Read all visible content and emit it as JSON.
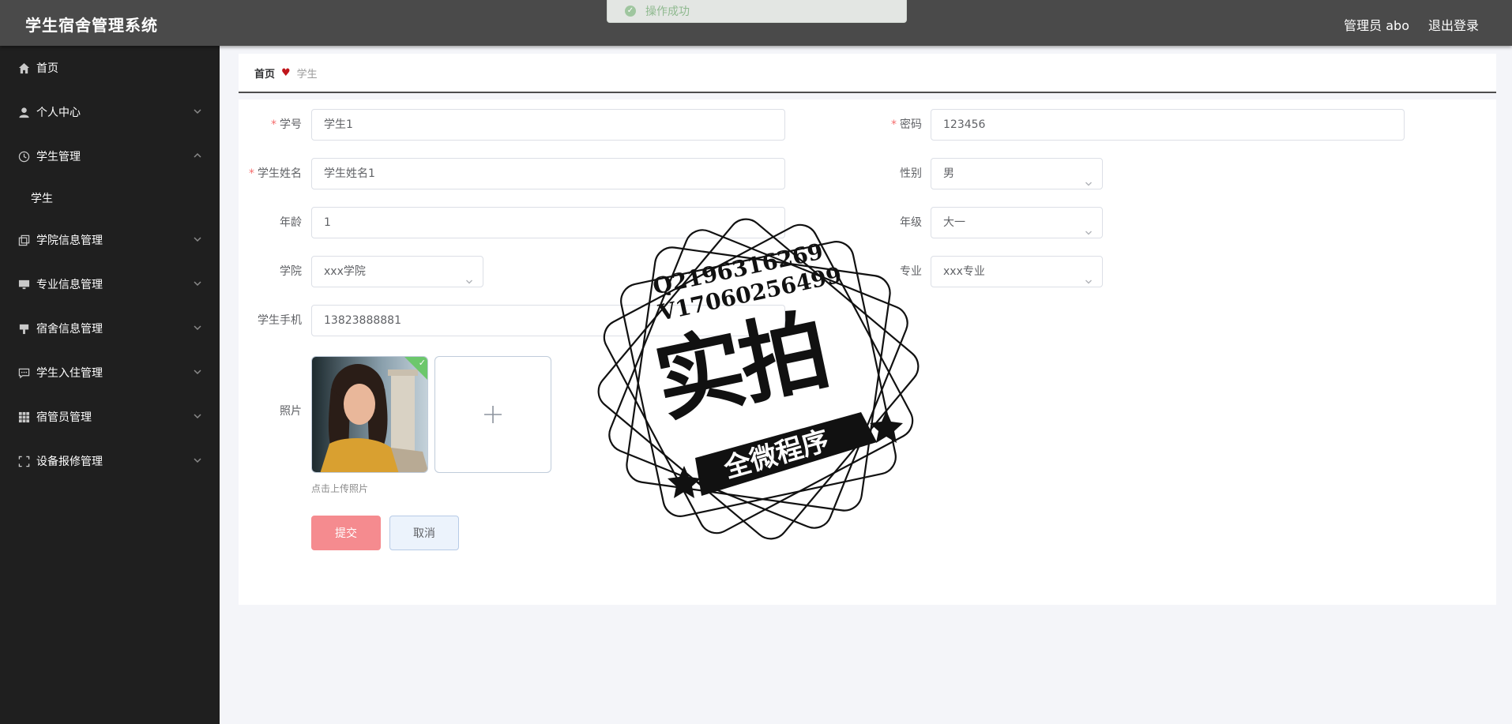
{
  "header": {
    "title": "学生宿舍管理系统",
    "user_label": "管理员 abo",
    "logout_label": "退出登录"
  },
  "toast": {
    "text": "操作成功"
  },
  "sidebar": {
    "items": [
      {
        "label": "首页",
        "icon": "home-icon"
      },
      {
        "label": "个人中心",
        "icon": "user-icon"
      },
      {
        "label": "学生管理",
        "icon": "clock-icon",
        "sub": "学生"
      },
      {
        "label": "学院信息管理",
        "icon": "copy-icon"
      },
      {
        "label": "专业信息管理",
        "icon": "monitor-icon"
      },
      {
        "label": "宿舍信息管理",
        "icon": "stamp-icon"
      },
      {
        "label": "学生入住管理",
        "icon": "message-icon"
      },
      {
        "label": "宿管员管理",
        "icon": "grid-icon"
      },
      {
        "label": "设备报修管理",
        "icon": "fullscreen-icon"
      }
    ]
  },
  "breadcrumb": {
    "home": "首页",
    "current": "学生"
  },
  "form": {
    "student_no": {
      "label": "学号",
      "value": "学生1"
    },
    "password": {
      "label": "密码",
      "value": "123456"
    },
    "name": {
      "label": "学生姓名",
      "value": "学生姓名1"
    },
    "gender": {
      "label": "性别",
      "value": "男"
    },
    "age": {
      "label": "年龄",
      "value": "1"
    },
    "grade": {
      "label": "年级",
      "value": "大一"
    },
    "college": {
      "label": "学院",
      "value": "xxx学院"
    },
    "major": {
      "label": "专业",
      "value": "xxx专业"
    },
    "phone": {
      "label": "学生手机",
      "value": "13823888881"
    },
    "photo": {
      "label": "照片",
      "hint": "点击上传照片"
    },
    "submit_label": "提交",
    "cancel_label": "取消"
  },
  "watermark": {
    "line1": "Q2196316269",
    "line2": "V17060256499",
    "big": "实拍",
    "banner": "全微程序"
  },
  "colors": {
    "header_bg": "#4a4a4a",
    "sidebar_bg": "#1f1f1f",
    "submit": "#f58b8f",
    "required": "#f56c6c"
  }
}
